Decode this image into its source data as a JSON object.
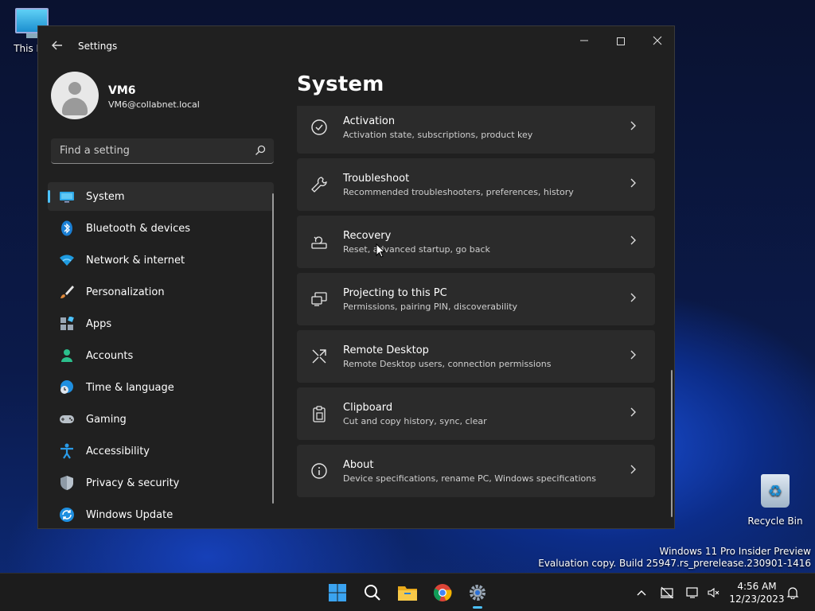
{
  "desktop": {
    "this_pc_label": "This P",
    "recycle_bin_label": "Recycle Bin",
    "watermark_line1": "Windows 11 Pro Insider Preview",
    "watermark_line2": "Evaluation copy. Build 25947.rs_prerelease.230901-1416"
  },
  "window": {
    "title": "Settings",
    "back_icon": "back-arrow-icon",
    "controls": [
      "minimize",
      "maximize",
      "close"
    ]
  },
  "account": {
    "name": "VM6",
    "email": "VM6@collabnet.local"
  },
  "search": {
    "placeholder": "Find a setting"
  },
  "nav": {
    "items": [
      {
        "label": "System",
        "icon": "system-icon",
        "active": true
      },
      {
        "label": "Bluetooth & devices",
        "icon": "bluetooth-icon"
      },
      {
        "label": "Network & internet",
        "icon": "wifi-icon"
      },
      {
        "label": "Personalization",
        "icon": "brush-icon"
      },
      {
        "label": "Apps",
        "icon": "apps-icon"
      },
      {
        "label": "Accounts",
        "icon": "person-icon"
      },
      {
        "label": "Time & language",
        "icon": "globe-clock-icon"
      },
      {
        "label": "Gaming",
        "icon": "gamepad-icon"
      },
      {
        "label": "Accessibility",
        "icon": "accessibility-icon"
      },
      {
        "label": "Privacy & security",
        "icon": "shield-icon"
      },
      {
        "label": "Windows Update",
        "icon": "update-icon"
      }
    ]
  },
  "main": {
    "page_title": "System",
    "cards": [
      {
        "title": "Activation",
        "subtitle": "Activation state, subscriptions, product key",
        "icon": "check-circle-icon"
      },
      {
        "title": "Troubleshoot",
        "subtitle": "Recommended troubleshooters, preferences, history",
        "icon": "wrench-icon"
      },
      {
        "title": "Recovery",
        "subtitle": "Reset, advanced startup, go back",
        "icon": "recovery-icon"
      },
      {
        "title": "Projecting to this PC",
        "subtitle": "Permissions, pairing PIN, discoverability",
        "icon": "projecting-icon"
      },
      {
        "title": "Remote Desktop",
        "subtitle": "Remote Desktop users, connection permissions",
        "icon": "remote-desktop-icon"
      },
      {
        "title": "Clipboard",
        "subtitle": "Cut and copy history, sync, clear",
        "icon": "clipboard-icon"
      },
      {
        "title": "About",
        "subtitle": "Device specifications, rename PC, Windows specifications",
        "icon": "info-icon"
      }
    ]
  },
  "taskbar": {
    "apps": [
      "start-icon",
      "search-icon",
      "file-explorer-icon",
      "chrome-icon",
      "settings-icon"
    ],
    "time": "4:56 AM",
    "date": "12/23/2023"
  },
  "colors": {
    "accent": "#4cc2ff",
    "window_bg": "#202020",
    "card_bg": "#2b2b2b"
  }
}
